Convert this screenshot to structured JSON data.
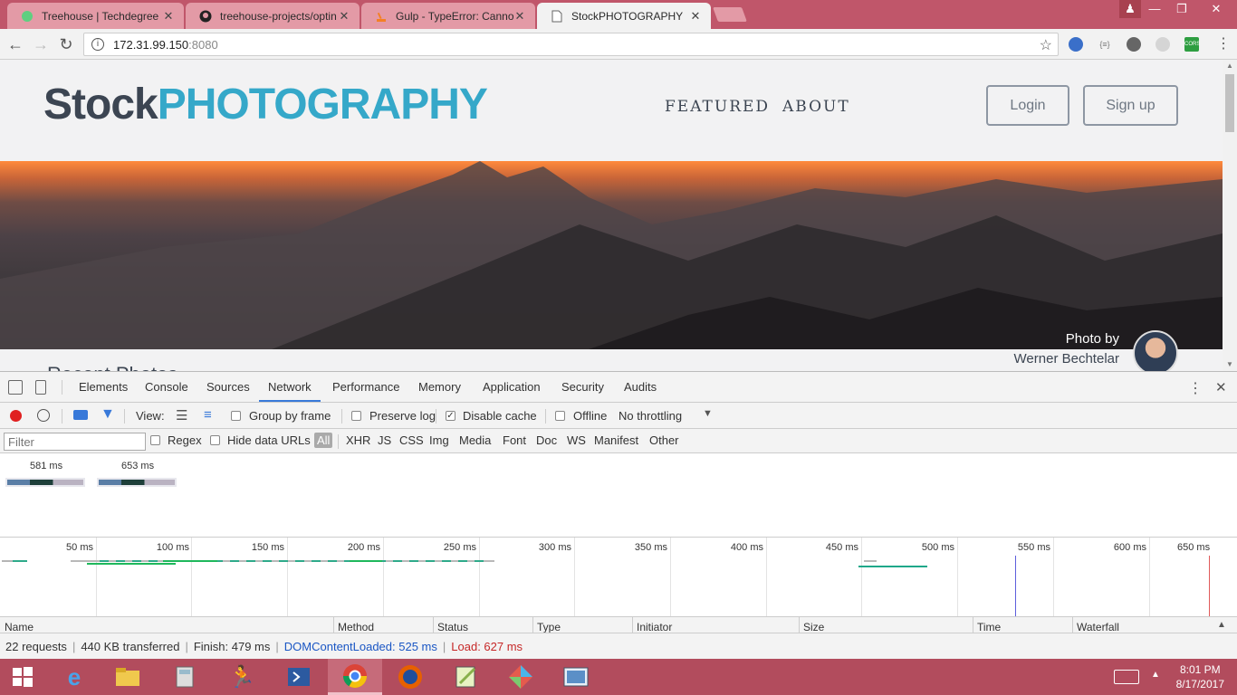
{
  "browser": {
    "tabs": [
      {
        "label": "Treehouse | Techdegree",
        "icon": "treehouse-icon",
        "active": false
      },
      {
        "label": "treehouse-projects/optin",
        "icon": "github-icon",
        "active": false
      },
      {
        "label": "Gulp - TypeError: Cannot",
        "icon": "stackoverflow-icon",
        "active": false
      },
      {
        "label": "StockPHOTOGRAPHY",
        "icon": "page-icon",
        "active": true
      }
    ],
    "close_glyph": "✕",
    "url_host": "172.31.99.150",
    "url_port": ":8080",
    "ext_cors": "CORS"
  },
  "site": {
    "logo_part1": "Stock",
    "logo_part2": "PHOTOGRAPHY",
    "nav": [
      "FEATURED",
      "ABOUT"
    ],
    "login": "Login",
    "signup": "Sign up",
    "credit_by": "Photo by",
    "credit_name": "Werner Bechtelar",
    "subheading": "Recent Photos"
  },
  "devtools": {
    "tabs": [
      "Elements",
      "Console",
      "Sources",
      "Network",
      "Performance",
      "Memory",
      "Application",
      "Security",
      "Audits"
    ],
    "active_tab": "Network",
    "controls": {
      "view_label": "View:",
      "group_by_frame": "Group by frame",
      "preserve_log": "Preserve log",
      "disable_cache": "Disable cache",
      "offline": "Offline",
      "throttling": "No throttling"
    },
    "filter": {
      "placeholder": "Filter",
      "regex": "Regex",
      "hide_data_urls": "Hide data URLs",
      "types": [
        "All",
        "XHR",
        "JS",
        "CSS",
        "Img",
        "Media",
        "Font",
        "Doc",
        "WS",
        "Manifest",
        "Other"
      ]
    },
    "screenshots": [
      "581 ms",
      "653 ms"
    ],
    "timeline_labels": [
      "50 ms",
      "100 ms",
      "150 ms",
      "200 ms",
      "250 ms",
      "300 ms",
      "350 ms",
      "400 ms",
      "450 ms",
      "500 ms",
      "550 ms",
      "600 ms",
      "650 ms"
    ],
    "columns": [
      "Name",
      "Method",
      "Status",
      "Type",
      "Initiator",
      "Size",
      "Time",
      "Waterfall"
    ],
    "status": {
      "requests": "22 requests",
      "transferred": "440 KB transferred",
      "finish": "Finish: 479 ms",
      "dcl": "DOMContentLoaded: 525 ms",
      "load": "Load: 627 ms"
    }
  },
  "taskbar": {
    "time": "8:01 PM",
    "date": "8/17/2017"
  },
  "colors": {
    "logo_dark": "#3c4552",
    "logo_accent": "#35a8c9",
    "devtools_accent": "#3879d9",
    "dcl_blue": "#1a56c4",
    "load_red": "#c62828"
  }
}
